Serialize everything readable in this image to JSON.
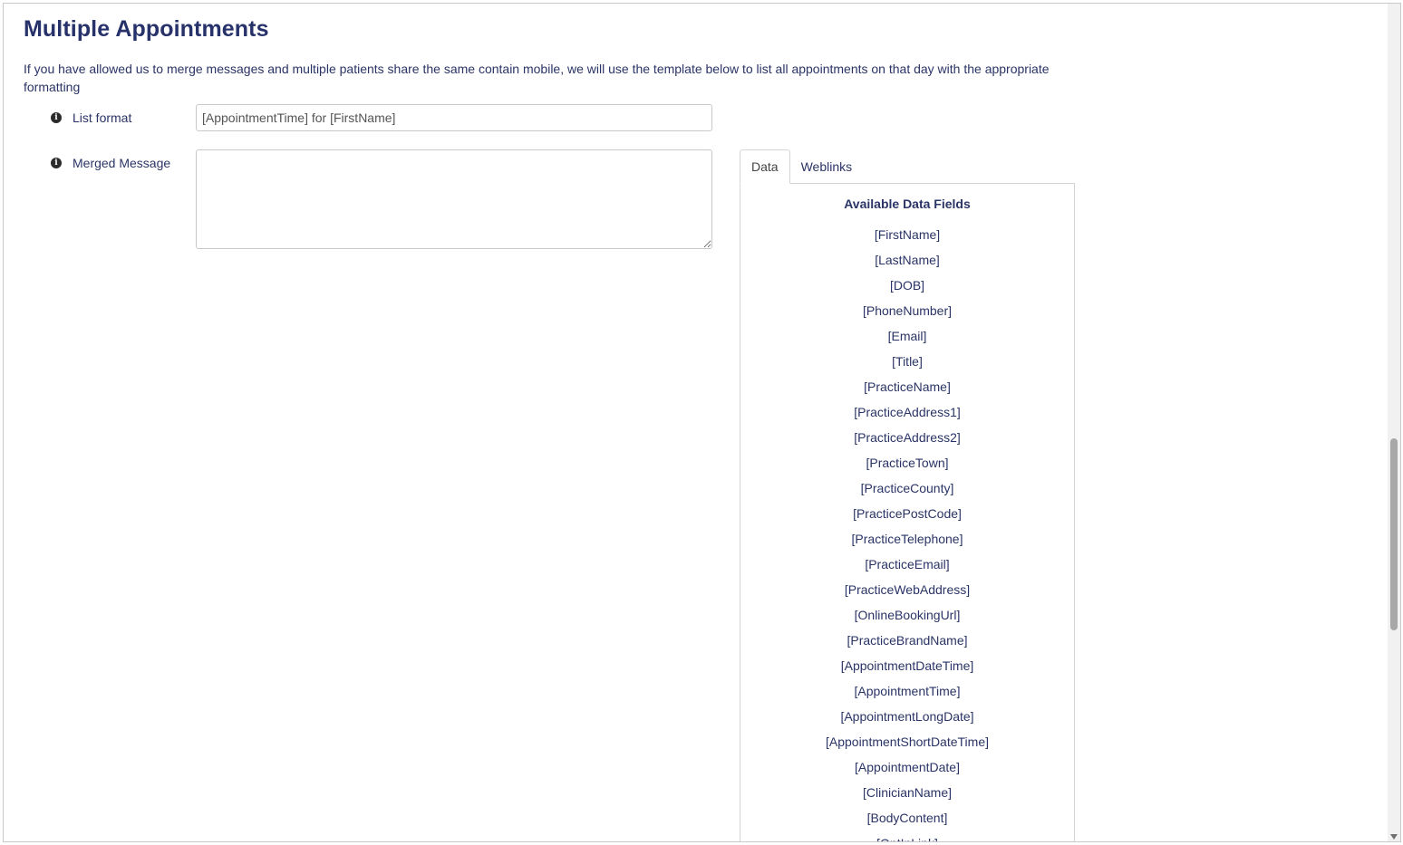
{
  "page": {
    "title": "Multiple Appointments",
    "description": "If you have allowed us to merge messages and multiple patients share the same contain mobile, we will use the template below to list all appointments on that day with the appropriate formatting"
  },
  "form": {
    "list_format": {
      "label": "List format",
      "value": "[AppointmentTime] for [FirstName]"
    },
    "merged_message": {
      "label": "Merged Message",
      "value": ""
    }
  },
  "tabs": [
    {
      "label": "Data",
      "active": true
    },
    {
      "label": "Weblinks",
      "active": false
    }
  ],
  "data_panel": {
    "title": "Available Data Fields",
    "fields": [
      "[FirstName]",
      "[LastName]",
      "[DOB]",
      "[PhoneNumber]",
      "[Email]",
      "[Title]",
      "[PracticeName]",
      "[PracticeAddress1]",
      "[PracticeAddress2]",
      "[PracticeTown]",
      "[PracticeCounty]",
      "[PracticePostCode]",
      "[PracticeTelephone]",
      "[PracticeEmail]",
      "[PracticeWebAddress]",
      "[OnlineBookingUrl]",
      "[PracticeBrandName]",
      "[AppointmentDateTime]",
      "[AppointmentTime]",
      "[AppointmentLongDate]",
      "[AppointmentShortDateTime]",
      "[AppointmentDate]",
      "[ClinicianName]",
      "[BodyContent]",
      "[OptInLink]"
    ]
  },
  "icons": {
    "info": "info-circle-icon"
  },
  "colors": {
    "heading": "#27316a",
    "text": "#2a3466",
    "border": "#c9c9c9"
  }
}
